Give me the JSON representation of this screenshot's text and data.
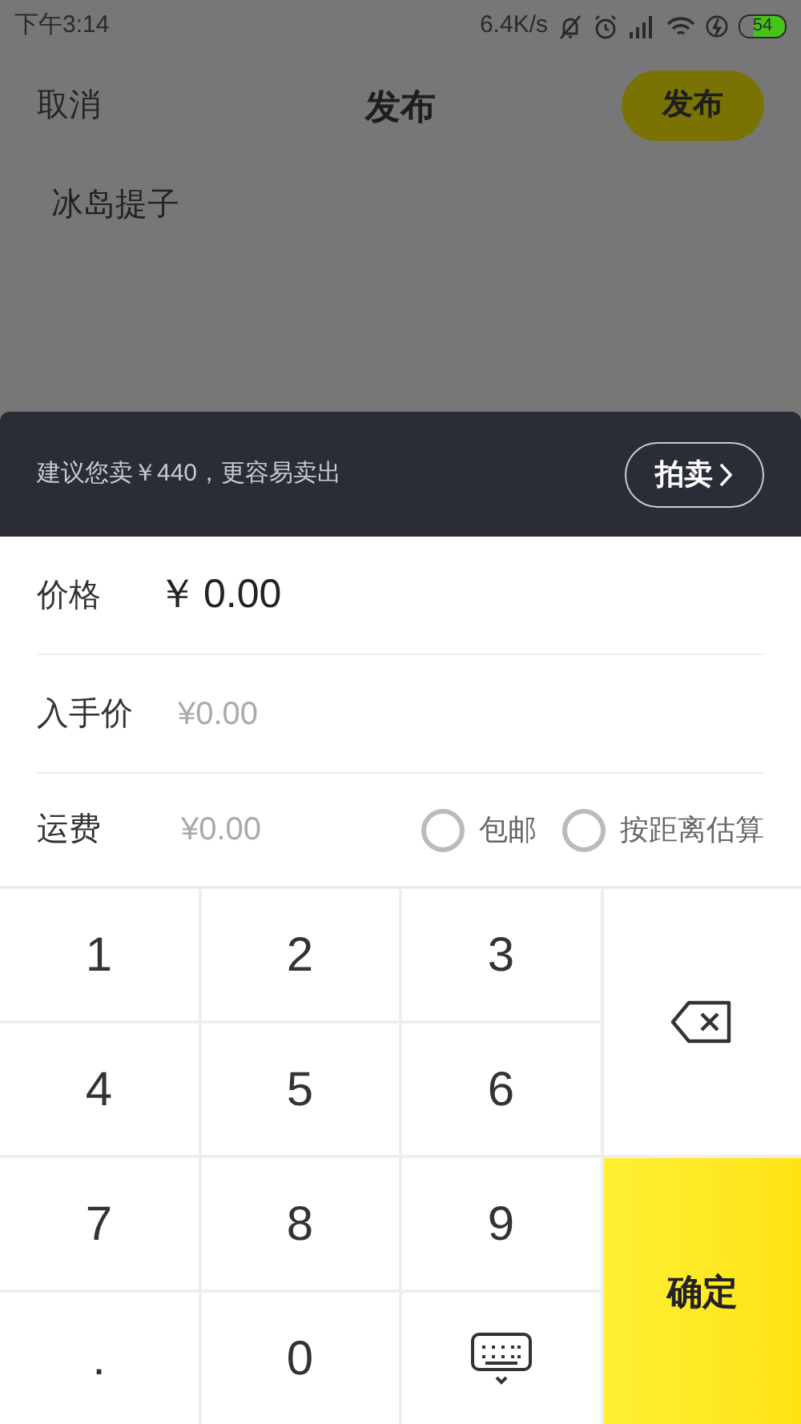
{
  "status_bar": {
    "time": "下午3:14",
    "speed": "6.4K/s",
    "battery": "54"
  },
  "header": {
    "cancel": "取消",
    "title": "发布",
    "publish": "发布"
  },
  "description": "冰岛提子",
  "suggestion": {
    "text": "建议您卖￥440，更容易卖出",
    "button": "拍卖"
  },
  "form": {
    "price": {
      "label": "价格",
      "currency": "￥",
      "value": "0.00"
    },
    "cost": {
      "label": "入手价",
      "placeholder": "¥0.00"
    },
    "shipping": {
      "label": "运费",
      "placeholder": "¥0.00",
      "options": [
        {
          "label": "包邮",
          "checked": false
        },
        {
          "label": "按距离估算",
          "checked": false
        }
      ]
    }
  },
  "keypad": {
    "keys": [
      {
        "kind": "digit",
        "label": "1"
      },
      {
        "kind": "digit",
        "label": "2"
      },
      {
        "kind": "digit",
        "label": "3"
      },
      {
        "kind": "backspace"
      },
      {
        "kind": "digit",
        "label": "4"
      },
      {
        "kind": "digit",
        "label": "5"
      },
      {
        "kind": "digit",
        "label": "6"
      },
      {
        "kind": "digit",
        "label": "7"
      },
      {
        "kind": "digit",
        "label": "8"
      },
      {
        "kind": "digit",
        "label": "9"
      },
      {
        "kind": "confirm",
        "label": "确定"
      },
      {
        "kind": "digit",
        "label": "."
      },
      {
        "kind": "digit",
        "label": "0"
      },
      {
        "kind": "hide"
      }
    ]
  }
}
